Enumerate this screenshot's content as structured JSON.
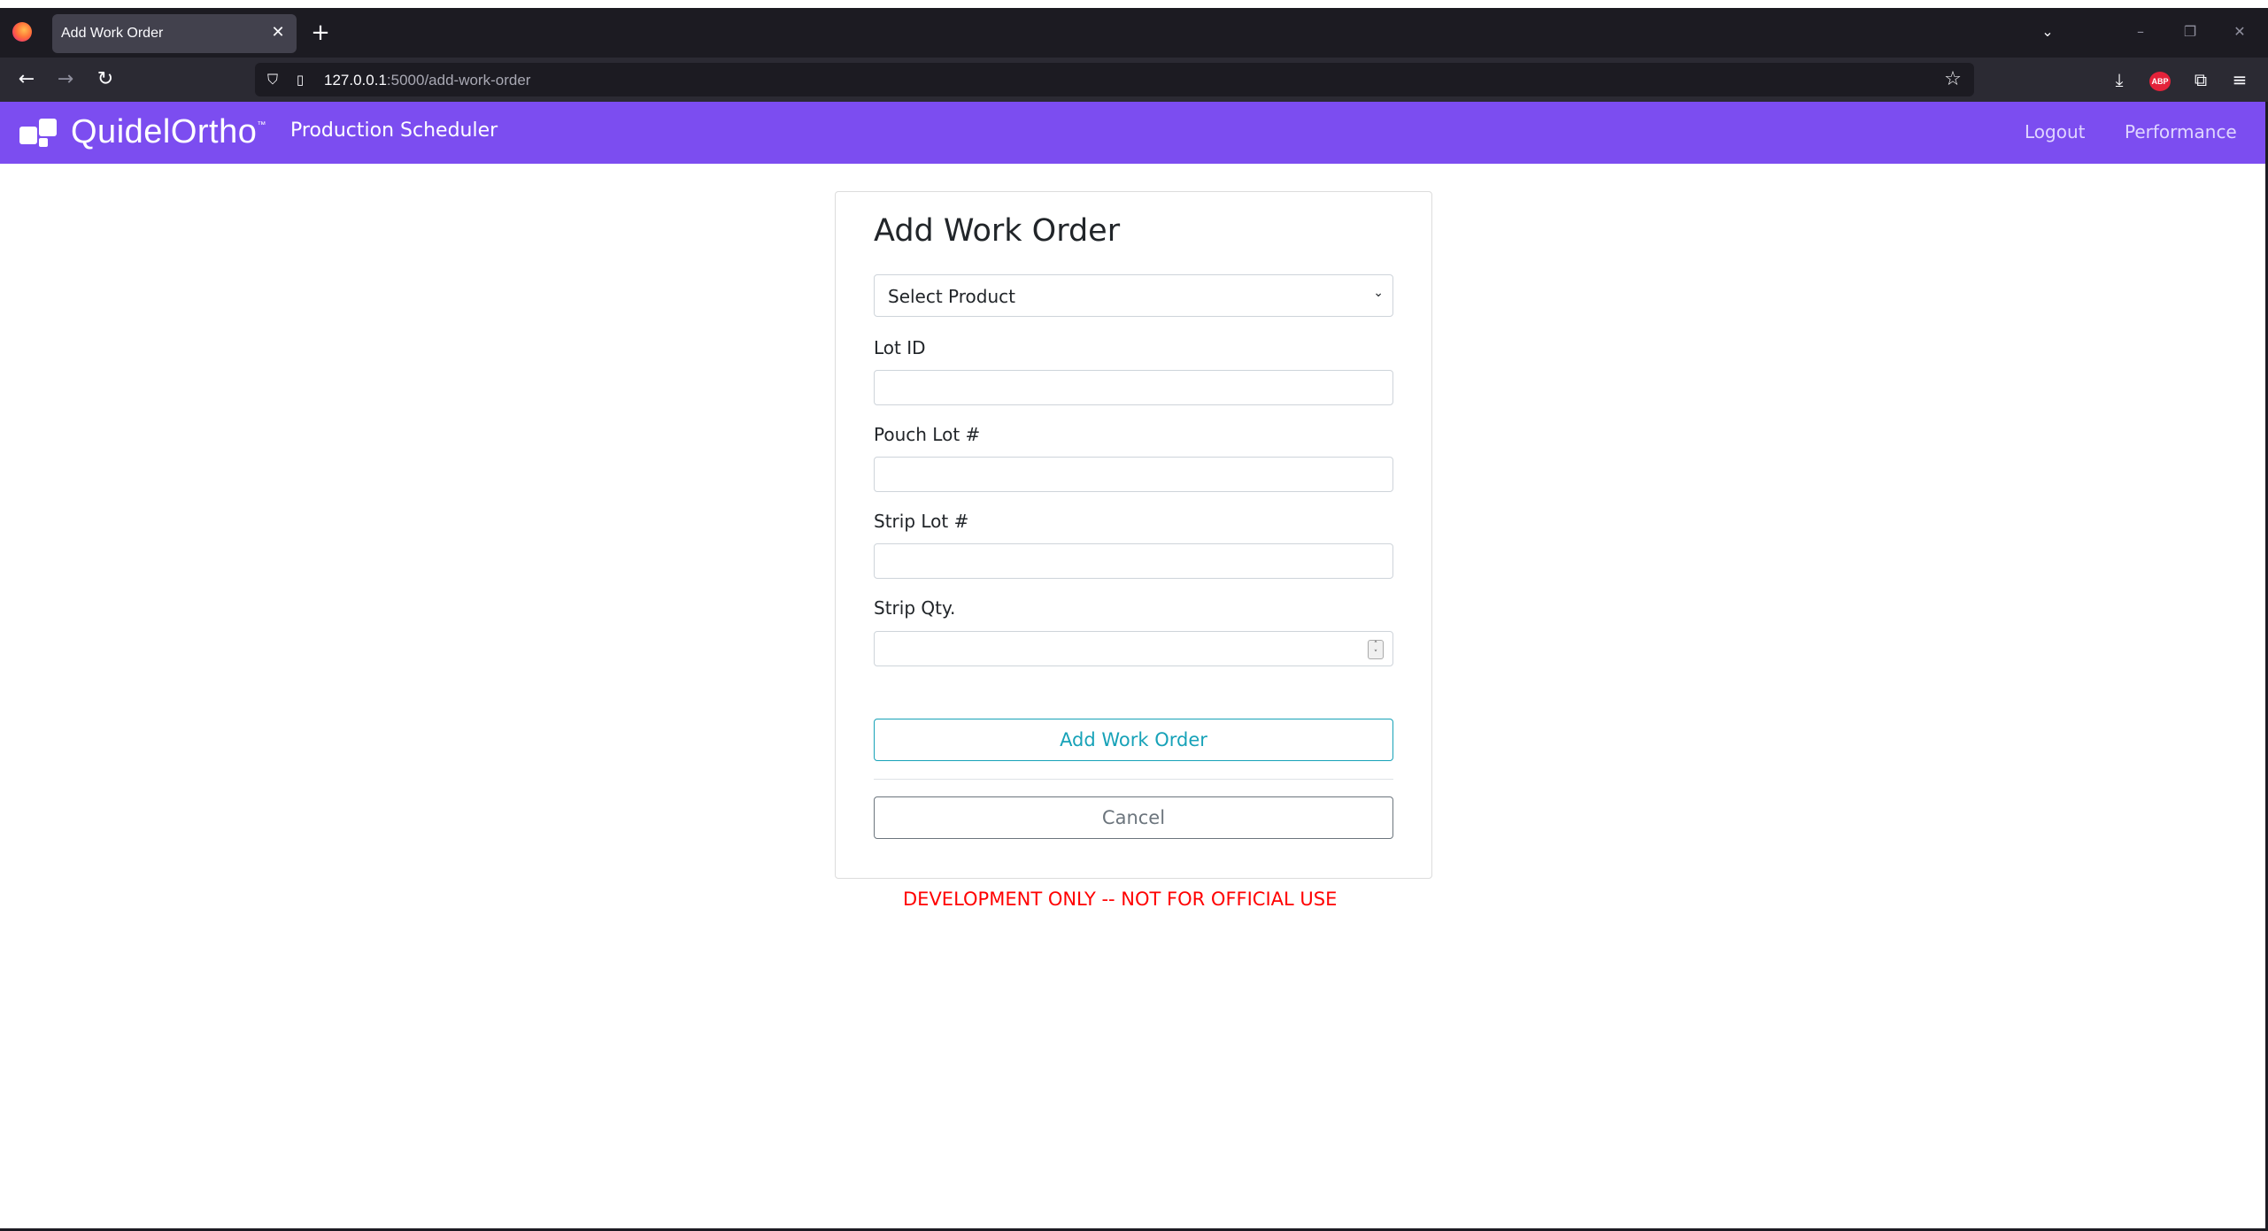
{
  "browser": {
    "tab_title": "Add Work Order",
    "tab_close": "✕",
    "new_tab": "+",
    "url_host": "127.0.0.1",
    "url_rest": ":5000/add-work-order",
    "abp_label": "ABP"
  },
  "header": {
    "brand": "QuidelOrtho",
    "brand_tm": "™",
    "app_name": "Production Scheduler",
    "nav": {
      "logout": "Logout",
      "performance": "Performance"
    },
    "accent_color": "#7c4df0"
  },
  "form": {
    "title": "Add Work Order",
    "product_select": {
      "value": "Select Product"
    },
    "fields": {
      "lot_id": {
        "label": "Lot ID",
        "value": ""
      },
      "pouch_lot": {
        "label": "Pouch Lot #",
        "value": ""
      },
      "strip_lot": {
        "label": "Strip Lot #",
        "value": ""
      },
      "strip_qty": {
        "label": "Strip Qty.",
        "value": ""
      }
    },
    "submit_label": "Add Work Order",
    "cancel_label": "Cancel"
  },
  "footer_note": "DEVELOPMENT ONLY -- NOT FOR OFFICIAL USE",
  "icons": [
    "firefox-icon",
    "close-icon",
    "plus-icon",
    "chevron-down-icon",
    "back-icon",
    "forward-icon",
    "reload-icon",
    "shield-icon",
    "page-icon",
    "star-icon",
    "download-icon",
    "adblock-icon",
    "extensions-icon",
    "menu-icon"
  ]
}
